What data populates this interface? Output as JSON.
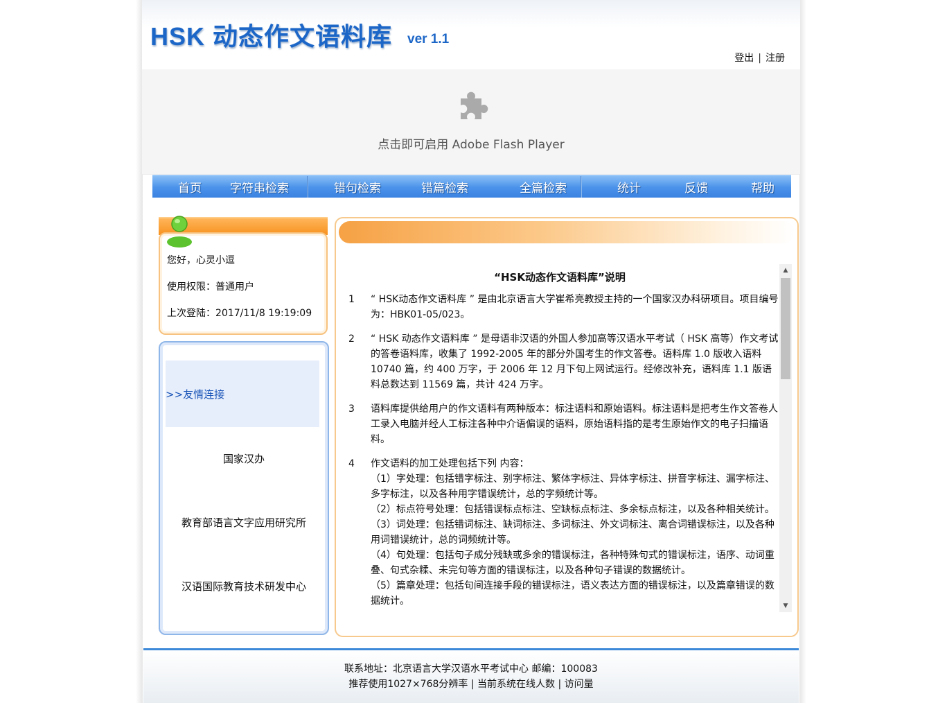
{
  "header": {
    "title": "HSK 动态作文语料库",
    "version": "ver 1.1",
    "login": "登出",
    "register": "注册",
    "separator": "|"
  },
  "flash": {
    "message": "点击即可启用 Adobe Flash Player",
    "icon": "puzzle-plugin-icon"
  },
  "nav": {
    "items": [
      "首页",
      "字符串检索",
      "错句检索",
      "错篇检索",
      "全篇检索",
      "统计",
      "反馈",
      "帮助"
    ]
  },
  "user": {
    "greeting": "您好，心灵小逗",
    "permission": "使用权限：普通用户",
    "last_login": "上次登陆：2017/11/8 19:19:09"
  },
  "links": {
    "header": ">>友情连接",
    "items": [
      "国家汉办",
      "教育部语言文字应用研究所",
      "汉语国际教育技术研发中心"
    ]
  },
  "doc": {
    "title": "“HSK动态作文语料库”说明",
    "paragraphs": [
      {
        "num": "1",
        "lines": [
          "“ HSK动态作文语料库 ” 是由北京语言大学崔希亮教授主持的一个国家汉办科研项目。项目编号为：HBK01-05/023。"
        ]
      },
      {
        "num": "2",
        "lines": [
          "“ HSK 动态作文语料库 ” 是母语非汉语的外国人参加高等汉语水平考试（ HSK 高等）作文考试的答卷语料库，收集了 1992-2005 年的部分外国考生的作文答卷。语料库 1.0 版收入语料 10740 篇，约 400 万字，于 2006 年 12 月下旬上网试运行。经修改补充，语料库 1.1 版语料总数达到 11569 篇，共计 424 万字。"
        ]
      },
      {
        "num": "3",
        "lines": [
          "语料库提供给用户的作文语料有两种版本：标注语料和原始语料。标注语料是把考生作文答卷人工录入电脑并经人工标注各种中介语偏误的语料，原始语料指的是考生原始作文的电子扫描语料。"
        ]
      },
      {
        "num": "4",
        "lines": [
          "作文语料的加工处理包括下列 内容：",
          "（1）字处理：包括错字标注、别字标注、繁体字标注、异体字标注、拼音字标注、漏字标注、多字标注，以及各种用字错误统计，总的字频统计等。",
          "（2）标点符号处理：包括错误标点标注、空缺标点标注、多余标点标注，以及各种相关统计。",
          "（3）词处理：包括错词标注、缺词标注、多词标注、外文词标注、离合词错误标注，以及各种用词错误统计，总的词频统计等。",
          "（4）句处理：包括句子成分残缺或多余的错误标注，各种特殊句式的错误标注，语序、动词重叠、句式杂糅、未完句等方面的错误标注，以及各种句子错误的数据统计。",
          "（5）篇章处理：包括句间连接手段的错误标注，语义表达方面的错误标注，以及篇章错误的数据统计。"
        ]
      }
    ]
  },
  "footer": {
    "line1": "联系地址：北京语言大学汉语水平考试中心   邮编：100083",
    "line2": "推荐使用1027×768分辨率 |   当前系统在线人数   |   访问量"
  }
}
